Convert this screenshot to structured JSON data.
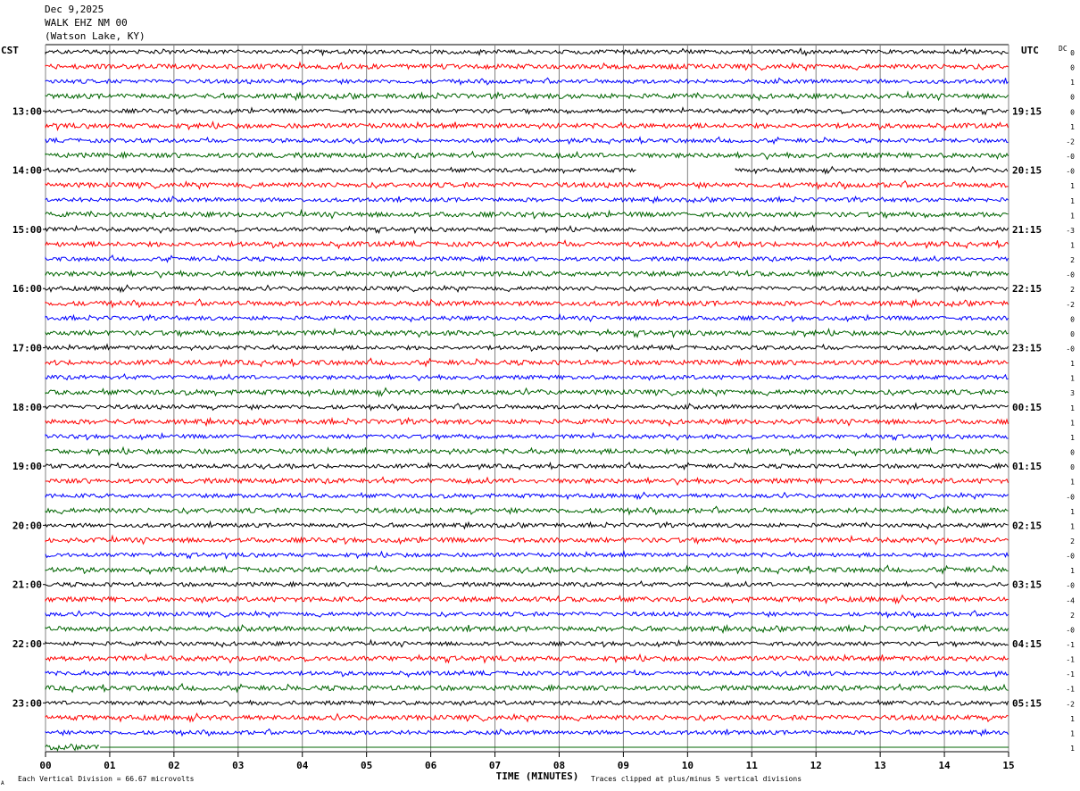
{
  "header": {
    "date": "Dec 9,2025",
    "station": "WALK EHZ NM 00",
    "location": "(Watson Lake, KY)"
  },
  "chart_data": {
    "type": "line",
    "title": "WALK EHZ NM 00",
    "left_axis_label": "CST",
    "right_axis_label": "UTC",
    "dc_label": "DC",
    "xlabel": "TIME (MINUTES)",
    "xlim": [
      0,
      15
    ],
    "x_ticks": [
      "00",
      "01",
      "02",
      "03",
      "04",
      "05",
      "06",
      "07",
      "08",
      "09",
      "10",
      "11",
      "12",
      "13",
      "14",
      "15"
    ],
    "cst_hour_labels": [
      "13:00",
      "14:00",
      "15:00",
      "16:00",
      "17:00",
      "18:00",
      "19:00",
      "20:00",
      "21:00",
      "22:00",
      "23:00"
    ],
    "utc_hour_labels": [
      "19:15",
      "20:15",
      "21:15",
      "22:15",
      "23:15",
      "00:15",
      "01:15",
      "02:15",
      "03:15",
      "04:15",
      "05:15"
    ],
    "first_labeled_trace": 4,
    "traces_per_hour": 4,
    "trace_colors": [
      "#000000",
      "#ff0000",
      "#0000ff",
      "#006400"
    ],
    "dc_offsets": [
      "0",
      "0",
      "1",
      "0",
      "0",
      "1",
      "-2",
      "-0",
      "-0",
      "1",
      "1",
      "1",
      "-3",
      "1",
      "2",
      "-0",
      "2",
      "-2",
      "0",
      "0",
      "-0",
      "1",
      "1",
      "3",
      "1",
      "1",
      "1",
      "0",
      "0",
      "1",
      "-0",
      "1",
      "1",
      "2",
      "-0",
      "1",
      "-0",
      "-4",
      "2",
      "-0",
      "-1",
      "-1",
      "-1",
      "-1",
      "-2",
      "1",
      "1",
      "1"
    ],
    "data_gap": {
      "trace": 8,
      "start_min": 9.2,
      "end_min": 10.75
    },
    "last_trace_end_min": 0.85,
    "footer_left": "Each Vertical Division =   66.67 microvolts",
    "footer_right": "Traces clipped at plus/minus 5 vertical divisions",
    "corner_mark": "A"
  }
}
